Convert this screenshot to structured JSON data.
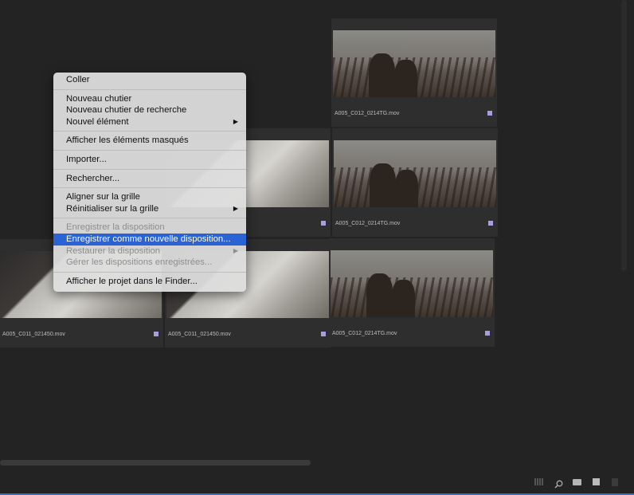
{
  "clips": [
    {
      "name": "A005_C012_0214TG.mov",
      "badge_color": "#a79ddf"
    },
    {
      "name": "A005_C012_0214TG.mov",
      "badge_color": "#a79ddf"
    },
    {
      "name": "A005_C012_0214TG.mov",
      "badge_color": "#a79ddf"
    },
    {
      "name": "A005_C011_021450.mov",
      "badge_color": "#a79ddf"
    },
    {
      "name": "A005_C011_021450.mov",
      "badge_color": "#a79ddf"
    }
  ],
  "menu": {
    "paste": "Coller",
    "new_bin": "Nouveau chutier",
    "new_search_bin": "Nouveau chutier de recherche",
    "new_item": "Nouvel élément",
    "show_hidden": "Afficher les éléments masqués",
    "import": "Importer...",
    "find": "Rechercher...",
    "align_grid": "Aligner sur la grille",
    "reset_grid": "Réinitialiser sur la grille",
    "save_layout": "Enregistrer la disposition",
    "save_new_layout": "Enregistrer comme nouvelle disposition...",
    "restore_layout": "Restaurer la disposition",
    "manage_layouts": "Gérer les dispositions enregistrées...",
    "reveal_finder": "Afficher le projet dans le Finder..."
  },
  "toolbar": {
    "icons": [
      "freeform-view-icon",
      "search-icon",
      "new-bin-icon",
      "new-item-icon",
      "trash-icon"
    ]
  }
}
